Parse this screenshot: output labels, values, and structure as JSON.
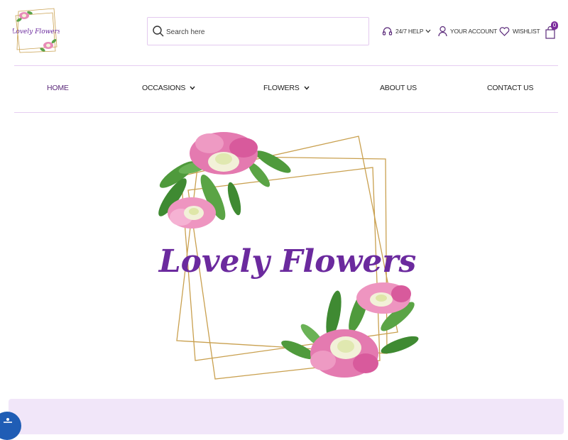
{
  "brand": {
    "name": "Lovely Flowers"
  },
  "search": {
    "placeholder": "Search here"
  },
  "header_links": {
    "help": "24/7 HELP",
    "account": "YOUR ACCOUNT",
    "wishlist": "WISHLIST"
  },
  "cart": {
    "count": "0"
  },
  "nav": {
    "home": "HOME",
    "occasions": "OCCASIONS",
    "flowers": "FLOWERS",
    "about": "ABOUT US",
    "contact": "CONTACT US"
  },
  "hero": {
    "logo_text": "Lovely Flowers"
  },
  "colors": {
    "accent": "#7b2b9c",
    "nav_active": "#5b2a7a",
    "divider": "#e6cdf1",
    "promo_bg": "#f1e6f9",
    "logo_script": "#6b2a9e",
    "frame_gold": "#c9a04f"
  },
  "icons": [
    "search-icon",
    "headset-icon",
    "user-icon",
    "heart-icon",
    "shopping-bag-icon",
    "chevron-down-icon",
    "accessibility-icon"
  ]
}
